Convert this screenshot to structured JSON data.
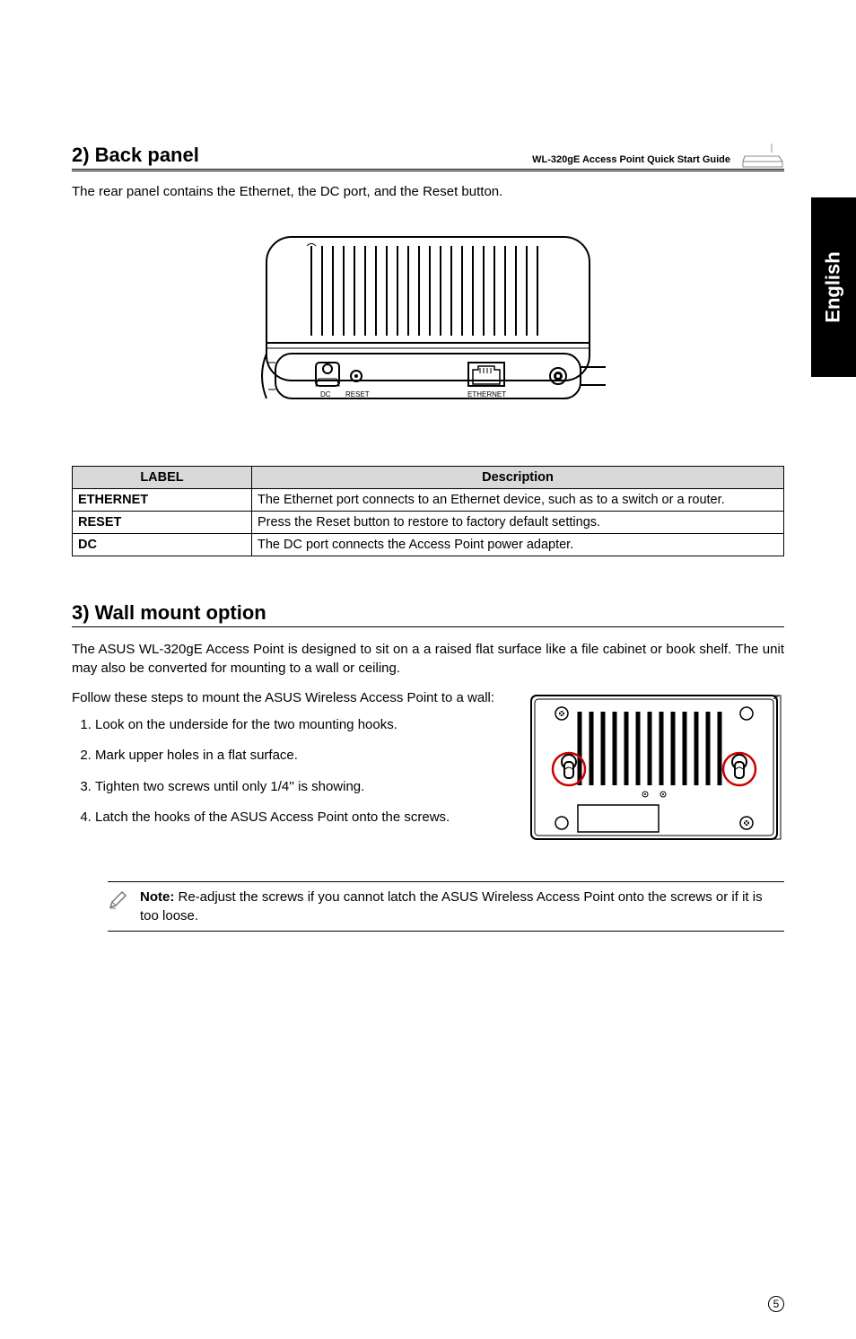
{
  "header": {
    "doc_title": "WL-320gE Access Point Quick Start Guide"
  },
  "side_tab": "English",
  "section1": {
    "title": "2) Back panel",
    "intro": "The rear panel contains the Ethernet, the DC port, and the Reset button.",
    "figure_labels": {
      "dc": "DC",
      "reset": "RESET",
      "ethernet": "ETHERNET"
    }
  },
  "table": {
    "headers": {
      "label": "LABEL",
      "desc": "Description"
    },
    "rows": [
      {
        "label": "ETHERNET",
        "desc": "The Ethernet port connects to an Ethernet device, such as to a switch or a router."
      },
      {
        "label": "RESET",
        "desc": "Press the Reset button to restore to factory default settings."
      },
      {
        "label": "DC",
        "desc": "The DC port connects the Access Point power adapter."
      }
    ]
  },
  "section2": {
    "title": "3) Wall mount option",
    "intro": "The ASUS WL-320gE Access Point is designed to sit on a a raised flat surface like a file cabinet or book shelf. The unit may also be converted for mounting to a wall or ceiling.",
    "follow": "Follow these steps to mount the ASUS Wireless Access Point to a wall:",
    "steps": [
      "Look on the underside for the two mounting hooks.",
      "Mark  upper holes in a flat surface.",
      "Tighten two screws until only 1/4'' is showing.",
      "Latch the hooks of the ASUS Access Point onto the screws."
    ]
  },
  "note": {
    "label": "Note:",
    "text": " Re-adjust the screws if you cannot latch the ASUS Wireless Access Point onto the screws or if it is too loose."
  },
  "page_number": "5"
}
